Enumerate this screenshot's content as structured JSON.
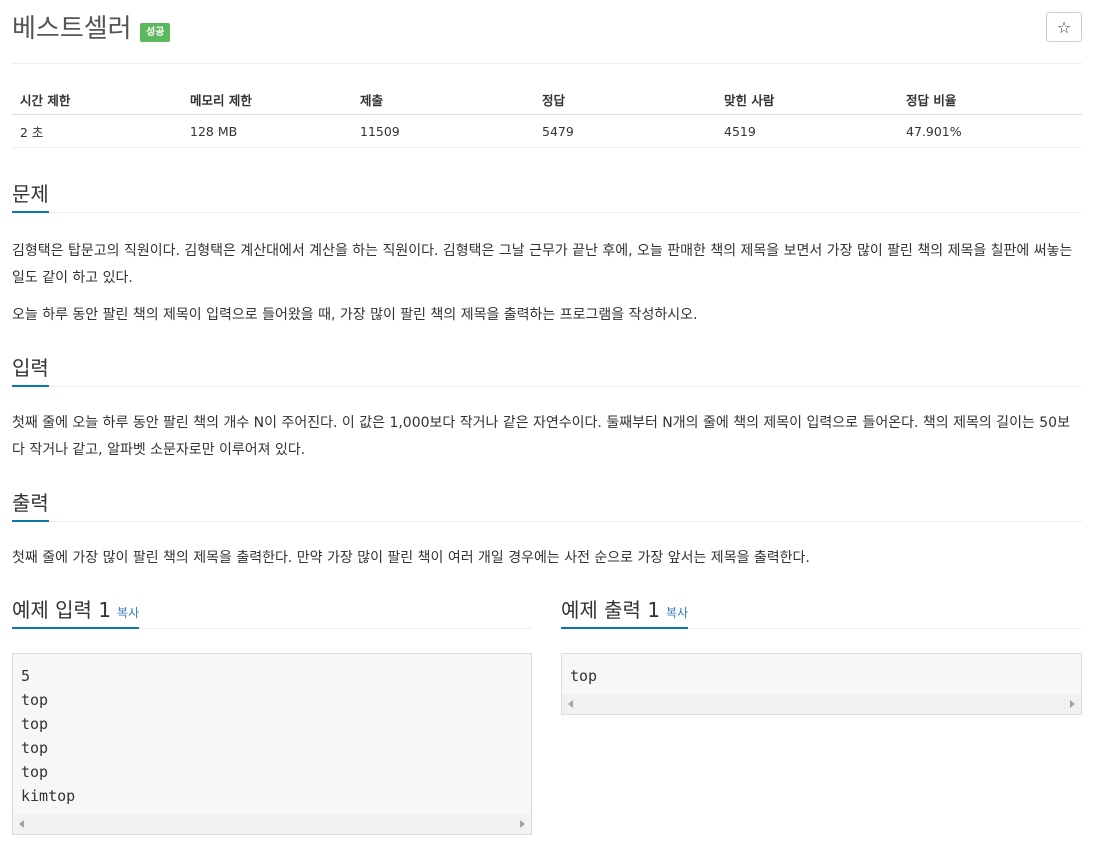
{
  "title": {
    "text": "베스트셀러",
    "badge": "성공",
    "star": "☆"
  },
  "info": {
    "headers": [
      "시간 제한",
      "메모리 제한",
      "제출",
      "정답",
      "맞힌 사람",
      "정답 비율"
    ],
    "values": [
      "2 초",
      "128 MB",
      "11509",
      "5479",
      "4519",
      "47.901%"
    ]
  },
  "problem": {
    "heading": "문제",
    "paragraphs": [
      "김형택은 탑문고의 직원이다. 김형택은 계산대에서 계산을 하는 직원이다. 김형택은 그날 근무가 끝난 후에, 오늘 판매한 책의 제목을 보면서 가장 많이 팔린 책의 제목을 칠판에 써놓는 일도 같이 하고 있다.",
      "오늘 하루 동안 팔린 책의 제목이 입력으로 들어왔을 때, 가장 많이 팔린 책의 제목을 출력하는 프로그램을 작성하시오."
    ]
  },
  "input": {
    "heading": "입력",
    "text": "첫째 줄에 오늘 하루 동안 팔린 책의 개수 N이 주어진다. 이 값은 1,000보다 작거나 같은 자연수이다. 둘째부터 N개의 줄에 책의 제목이 입력으로 들어온다. 책의 제목의 길이는 50보다 작거나 같고, 알파벳 소문자로만 이루어져 있다."
  },
  "output": {
    "heading": "출력",
    "text": "첫째 줄에 가장 많이 팔린 책의 제목을 출력한다. 만약 가장 많이 팔린 책이 여러 개일 경우에는 사전 순으로 가장 앞서는 제목을 출력한다."
  },
  "samples": {
    "input_title": "예제 입력 1",
    "input_copy": "복사",
    "input_content": "5\ntop\ntop\ntop\ntop\nkimtop",
    "output_title": "예제 출력 1",
    "output_copy": "복사",
    "output_content": "top"
  },
  "colors": {
    "accent": "#0e76a8",
    "badge": "#5cb85c",
    "link": "#337ab7"
  }
}
